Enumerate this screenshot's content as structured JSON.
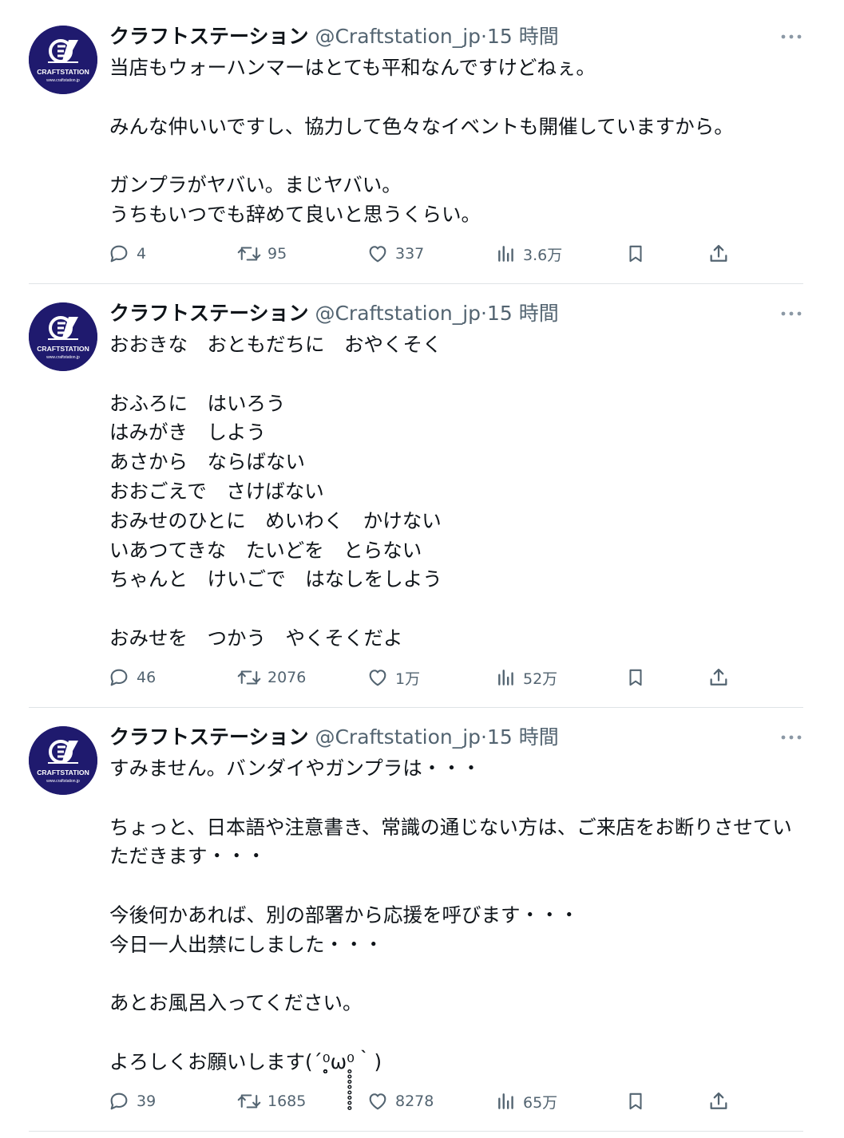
{
  "tweets": [
    {
      "avatar_text": "CRAFTSTATION",
      "avatar_url": "www.craftstation.jp",
      "display_name": "クラフトステーション",
      "handle": "@Craftstation_jp",
      "time": "15 時間",
      "text": "当店もウォーハンマーはとても平和なんですけどねぇ。\n\nみんな仲いいですし、協力して色々なイベントも開催していますから。\n\nガンプラがヤバい。まじヤバい。\nうちもいつでも辞めて良いと思うくらい。",
      "replies": "4",
      "retweets": "95",
      "likes": "337",
      "views": "3.6万"
    },
    {
      "avatar_text": "CRAFTSTATION",
      "avatar_url": "www.craftstation.jp",
      "display_name": "クラフトステーション",
      "handle": "@Craftstation_jp",
      "time": "15 時間",
      "text": "おおきな　おともだちに　おやくそく\n\nおふろに　はいろう\nはみがき　しよう\nあさから　ならばない\nおおごえで　さけばない\nおみせのひとに　めいわく　かけない\nいあつてきな　たいどを　とらない\nちゃんと　けいごで　はなしをしよう\n\nおみせを　つかう　やくそくだよ",
      "replies": "46",
      "retweets": "2076",
      "likes": "1万",
      "views": "52万"
    },
    {
      "avatar_text": "CRAFTSTATION",
      "avatar_url": "www.craftstation.jp",
      "display_name": "クラフトステーション",
      "handle": "@Craftstation_jp",
      "time": "15 時間",
      "text": "すみません。バンダイやガンプラは・・・\n\nちょっと、日本語や注意書き、常識の通じない方は、ご来店をお断りさせていただきます・・・\n\n今後何かあれば、別の部署から応援を呼びます・・・\n今日一人出禁にしました・・・\n\nあとお風呂入ってください。\n\nよろしくお願いします(´⁰̥̥̥̥̥̥̥̥ω⁰̥̥̥̥̥̥̥̥｀)",
      "replies": "39",
      "retweets": "1685",
      "likes": "8278",
      "views": "65万"
    }
  ],
  "icons": {
    "reply": "reply-icon",
    "retweet": "retweet-icon",
    "like": "heart-icon",
    "views": "views-icon",
    "bookmark": "bookmark-icon",
    "share": "share-icon",
    "more": "more-icon"
  },
  "colors": {
    "text": "#0f1419",
    "secondary": "#536471",
    "divider": "#dfe3e6",
    "avatar_bg": "#1f1a6e"
  }
}
